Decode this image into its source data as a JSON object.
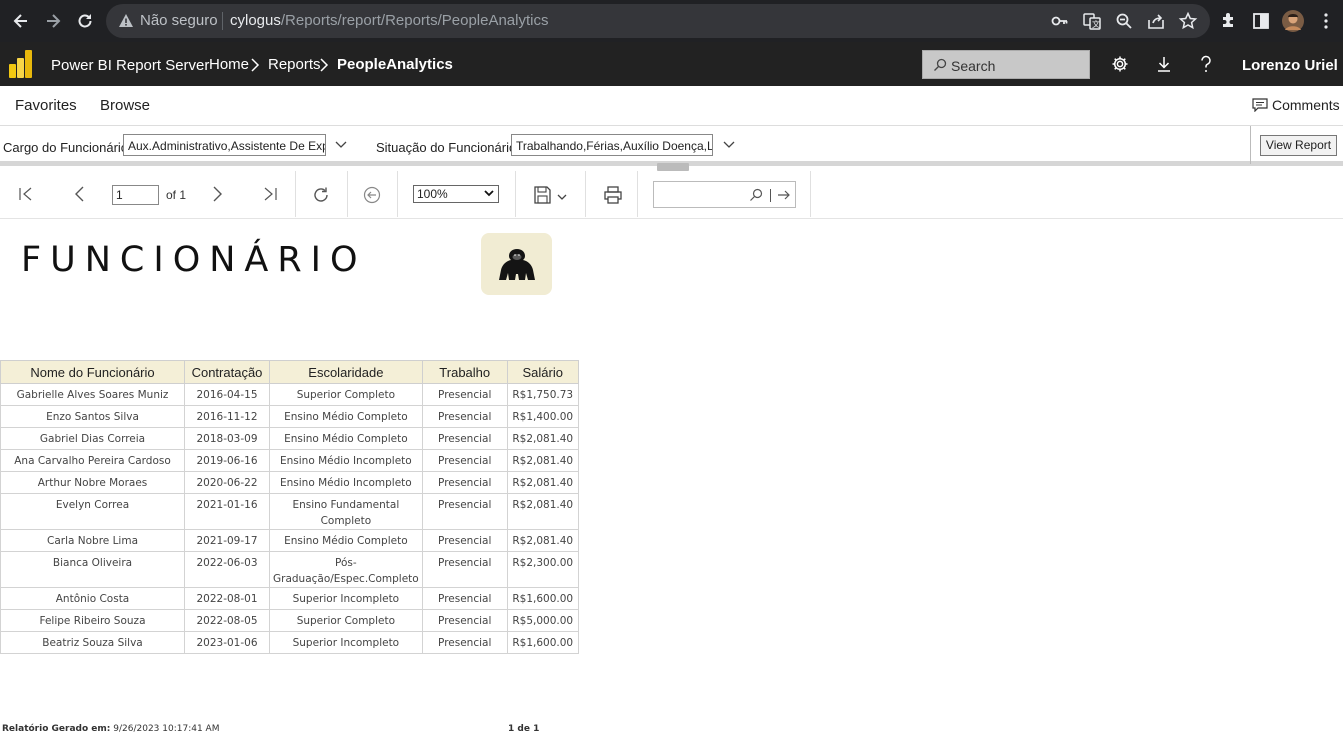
{
  "browser": {
    "security_label": "Não seguro",
    "url_host": "cylogus",
    "url_path": "/Reports/report/Reports/PeopleAnalytics"
  },
  "header": {
    "app_title": "Power BI Report Server",
    "breadcrumb": [
      "Home",
      "Reports",
      "PeopleAnalytics"
    ],
    "search_placeholder": "Search",
    "user_name": "Lorenzo Uriel"
  },
  "menu": {
    "favorites": "Favorites",
    "browse": "Browse",
    "comments": "Comments"
  },
  "parameters": {
    "cargo_label": "Cargo do Funcionário:",
    "cargo_value": "Aux.Administrativo,Assistente De Exp",
    "situacao_label": "Situação do Funcionário:",
    "situacao_value": "Trabalhando,Férias,Auxílio Doença,Li",
    "view_report": "View Report"
  },
  "toolbar": {
    "page_value": "1",
    "of_text": "of 1",
    "zoom_value": "100%"
  },
  "report": {
    "title": "FUNCIONÁRIO",
    "columns": [
      "Nome do Funcionário",
      "Contratação",
      "Escolaridade",
      "Trabalho",
      "Salário"
    ],
    "rows": [
      [
        "Gabrielle Alves Soares Muniz",
        "2016-04-15",
        "Superior Completo",
        "Presencial",
        "R$1,750.73"
      ],
      [
        "Enzo Santos Silva",
        "2016-11-12",
        "Ensino Médio Completo",
        "Presencial",
        "R$1,400.00"
      ],
      [
        "Gabriel Dias Correia",
        "2018-03-09",
        "Ensino Médio Completo",
        "Presencial",
        "R$2,081.40"
      ],
      [
        "Ana Carvalho Pereira Cardoso",
        "2019-06-16",
        "Ensino Médio Incompleto",
        "Presencial",
        "R$2,081.40"
      ],
      [
        "Arthur Nobre Moraes",
        "2020-06-22",
        "Ensino Médio Incompleto",
        "Presencial",
        "R$2,081.40"
      ],
      [
        "Evelyn Correa",
        "2021-01-16",
        "Ensino Fundamental Completo",
        "Presencial",
        "R$2,081.40"
      ],
      [
        "Carla Nobre Lima",
        "2021-09-17",
        "Ensino Médio Completo",
        "Presencial",
        "R$2,081.40"
      ],
      [
        "Bianca Oliveira",
        "2022-06-03",
        "Pós-Graduação/Espec.Completo",
        "Presencial",
        "R$2,300.00"
      ],
      [
        "Antônio Costa",
        "2022-08-01",
        "Superior Incompleto",
        "Presencial",
        "R$1,600.00"
      ],
      [
        "Felipe Ribeiro Souza",
        "2022-08-05",
        "Superior Completo",
        "Presencial",
        "R$5,000.00"
      ],
      [
        "Beatriz Souza Silva",
        "2023-01-06",
        "Superior Incompleto",
        "Presencial",
        "R$1,600.00"
      ]
    ],
    "footer_label": "Relatório Gerado em:",
    "footer_timestamp": "9/26/2023 10:17:41 AM",
    "footer_page": "1 de 1"
  },
  "colors": {
    "chrome_bg": "#202124",
    "pbi_header_bg": "#222222",
    "table_header_bg": "#f4efd7",
    "logo_bg": "#f1ecd3",
    "pbi_logo_yellow": "#f2c811"
  },
  "icons": [
    "back-icon",
    "forward-icon",
    "reload-icon",
    "warning-icon",
    "key-icon",
    "translate-icon",
    "zoom-icon",
    "share-icon",
    "star-icon",
    "extensions-icon",
    "sidepanel-icon",
    "profile-avatar",
    "kebab-icon",
    "pbi-logo-icon",
    "settings-icon",
    "download-icon",
    "help-icon",
    "comment-icon",
    "first-page-icon",
    "prev-page-icon",
    "next-page-icon",
    "last-page-icon",
    "refresh-icon",
    "back-to-parent-icon",
    "save-icon",
    "print-icon",
    "find-icon",
    "find-next-icon",
    "gorilla-icon"
  ]
}
